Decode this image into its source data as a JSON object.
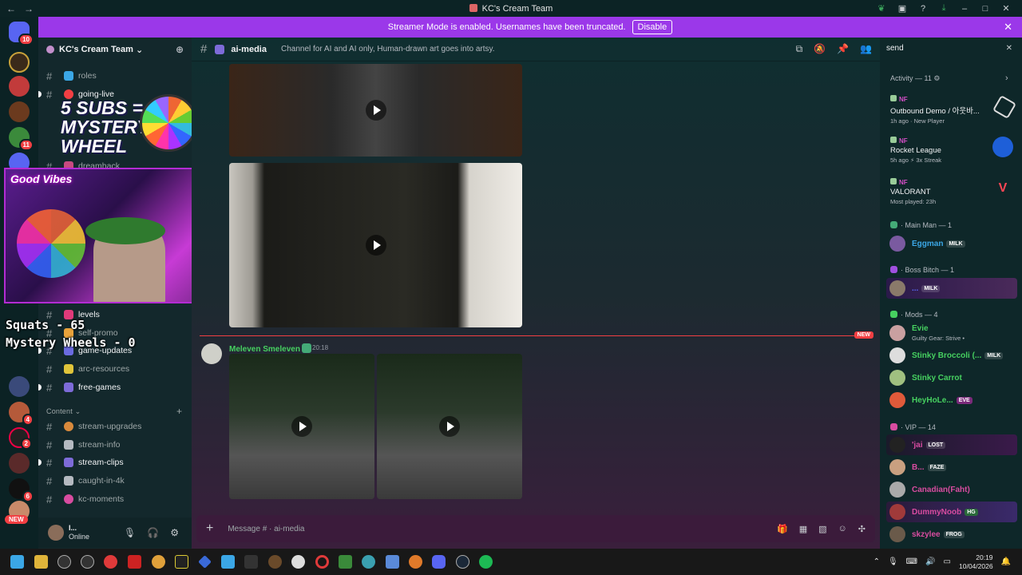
{
  "window": {
    "title": "KC's Cream Team"
  },
  "banner": {
    "text": "Streamer Mode is enabled. Usernames have been truncated.",
    "button": "Disable"
  },
  "server_rail": {
    "badges": [
      "10",
      "11",
      "4",
      "6",
      "2",
      "6"
    ],
    "new_label": "NEW"
  },
  "guild": {
    "name": "KC's Cream Team"
  },
  "channels": [
    {
      "name": "roles",
      "unread": false,
      "color": "#3ba7e6"
    },
    {
      "name": "going-live",
      "unread": true,
      "color": "#f23f43"
    },
    {
      "name": "dreamhack",
      "unread": false,
      "color": "#c84a80"
    },
    {
      "name": "levels",
      "unread": true,
      "color": "#e03a7a"
    },
    {
      "name": "self-promo",
      "unread": false,
      "color": "#e9a23b"
    },
    {
      "name": "game-updates",
      "unread": true,
      "color": "#6b6be0"
    },
    {
      "name": "arc-resources",
      "unread": false,
      "color": "#e0c43a"
    },
    {
      "name": "free-games",
      "unread": true,
      "color": "#7d6bd8"
    }
  ],
  "category": {
    "name": "Content"
  },
  "content_channels": [
    {
      "name": "stream-upgrades",
      "unread": false,
      "color": "#d98a3c"
    },
    {
      "name": "stream-info",
      "unread": false,
      "color": "#b5bac1"
    },
    {
      "name": "stream-clips",
      "unread": true,
      "color": "#7d6bd8"
    },
    {
      "name": "caught-in-4k",
      "unread": false,
      "color": "#b5bac1"
    },
    {
      "name": "kc-moments",
      "unread": false,
      "color": "#d84ca0"
    }
  ],
  "user": {
    "name": "I...",
    "status": "Online"
  },
  "overlay": {
    "wheel_line1": "5 SUBS =",
    "wheel_line2": "MYSTERY",
    "wheel_line3": "WHEEL",
    "good_vibes": "Good Vibes",
    "subs_label": "subs",
    "subs_count": "0",
    "squats": "Squats - 65",
    "mystery_wheels": "Mystery Wheels - 0"
  },
  "channel_header": {
    "name": "ai-media",
    "topic": "Channel for AI and AI only, Human-drawn art goes into artsy."
  },
  "message": {
    "author": "Meleven Smeleven",
    "time": "20:18"
  },
  "new_label": "NEW",
  "composer": {
    "placeholder": "Message # · ai-media"
  },
  "right_panel": {
    "search_value": "send",
    "activity_header": "Activity — 11",
    "activities": [
      {
        "tag": "NF",
        "title": "Outbound Demo / 아웃바...",
        "meta": "1h ago  ·  New Player"
      },
      {
        "tag": "NF",
        "title": "Rocket League",
        "meta": "5h ago  ⚡ 3x Streak"
      },
      {
        "tag": "NF",
        "title": "VALORANT",
        "meta": "Most played: 23h"
      }
    ],
    "groups": [
      {
        "label": "· Main Man — 1"
      },
      {
        "label": "· Boss Bitch — 1"
      },
      {
        "label": "· Mods — 4"
      },
      {
        "label": "· VIP — 14"
      }
    ],
    "members": [
      {
        "name": "Eggman",
        "tag": "MILK",
        "color": "#3ba7e6",
        "sub": ""
      },
      {
        "name": "...",
        "tag": "MILK",
        "color": "#5865f2",
        "sub": ""
      },
      {
        "name": "Evie",
        "tag": "",
        "color": "#46d160",
        "sub": "Guilty Gear: Strive •"
      },
      {
        "name": "Stinky Broccoli (...",
        "tag": "MILK",
        "color": "#46d160",
        "sub": ""
      },
      {
        "name": "Stinky Carrot",
        "tag": "",
        "color": "#46d160",
        "sub": ""
      },
      {
        "name": "HeyHoLe...",
        "tag": "EVE",
        "color": "#46d160",
        "sub": ""
      },
      {
        "name": "'jai",
        "tag": "LOST",
        "color": "#d84ca0",
        "sub": ""
      },
      {
        "name": "B...",
        "tag": "FAZE",
        "color": "#d84ca0",
        "sub": ""
      },
      {
        "name": "Canadian(Faht)",
        "tag": "",
        "color": "#d84ca0",
        "sub": ""
      },
      {
        "name": "DummyNoob",
        "tag": "HG",
        "color": "#d84ca0",
        "sub": ""
      },
      {
        "name": "skzylee",
        "tag": "FROG",
        "color": "#d84ca0",
        "sub": ""
      }
    ]
  },
  "taskbar": {
    "time": "20:19",
    "date": "10/04/2026"
  }
}
